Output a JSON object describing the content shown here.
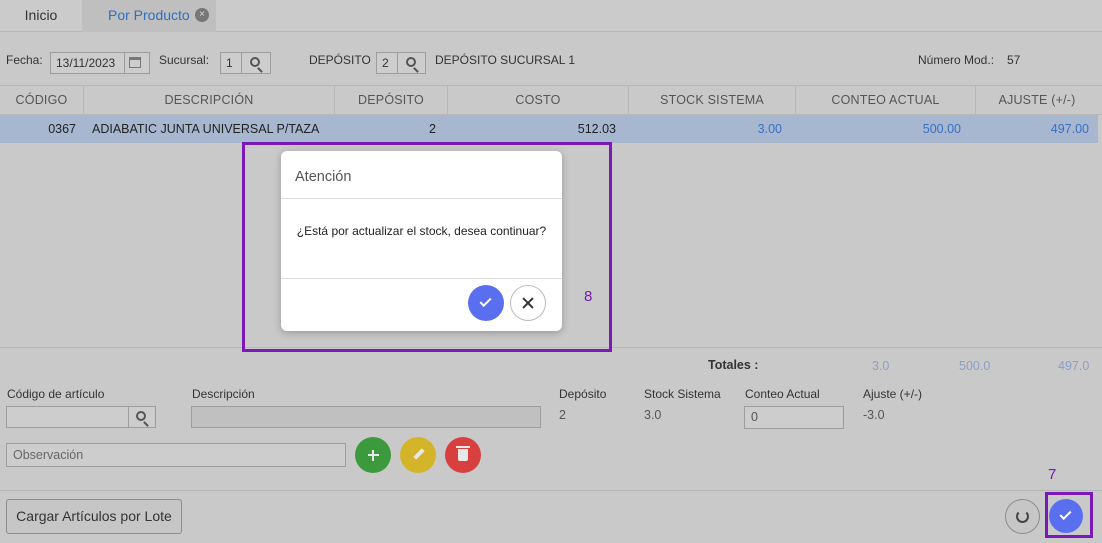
{
  "tabs": {
    "inicio": "Inicio",
    "producto": "Por Producto",
    "close_glyph": "×"
  },
  "filters": {
    "fecha_label": "Fecha:",
    "fecha_value": "13/11/2023",
    "sucursal_label": "Sucursal:",
    "sucursal_value": "1",
    "deposito_label": "DEPÓSITO",
    "deposito_value": "2",
    "deposito_name": "DEPÓSITO SUCURSAL 1",
    "numero_label": "Número Mod.:",
    "numero_value": "57"
  },
  "table": {
    "headers": [
      "CÓDIGO",
      "DESCRIPCIÓN",
      "DEPÓSITO",
      "COSTO",
      "STOCK SISTEMA",
      "CONTEO ACTUAL",
      "AJUSTE (+/-)"
    ],
    "rows": [
      {
        "codigo": "0367",
        "descripcion": "ADIABATIC JUNTA UNIVERSAL P/TAZA",
        "deposito": "2",
        "costo": "512.03",
        "stock": "3.00",
        "conteo": "500.00",
        "ajuste": "497.00"
      }
    ]
  },
  "totals": {
    "label": "Totales :",
    "stock": "3.0",
    "conteo": "500.0",
    "ajuste": "497.0"
  },
  "form": {
    "codigo_label": "Código de artículo",
    "codigo_value": "",
    "descripcion_label": "Descripción",
    "descripcion_value": "",
    "deposito_label": "Depósito",
    "deposito_value": "2",
    "stock_label": "Stock Sistema",
    "stock_value": "3.0",
    "conteo_label": "Conteo Actual",
    "conteo_value": "0",
    "ajuste_label": "Ajuste (+/-)",
    "ajuste_value": "-3.0",
    "observacion_placeholder": "Observación"
  },
  "buttons": {
    "lote": "Cargar Artículos por Lote"
  },
  "modal": {
    "title": "Atención",
    "message": "¿Está por actualizar el stock, desea continuar?"
  },
  "annotations": {
    "modal_marker": "8",
    "confirm_marker": "7"
  },
  "colors": {
    "primary": "#5a6ff0",
    "green": "#3c9a3c",
    "yellow": "#d4b52a",
    "red": "#d84040",
    "marker": "#7a18b8"
  }
}
